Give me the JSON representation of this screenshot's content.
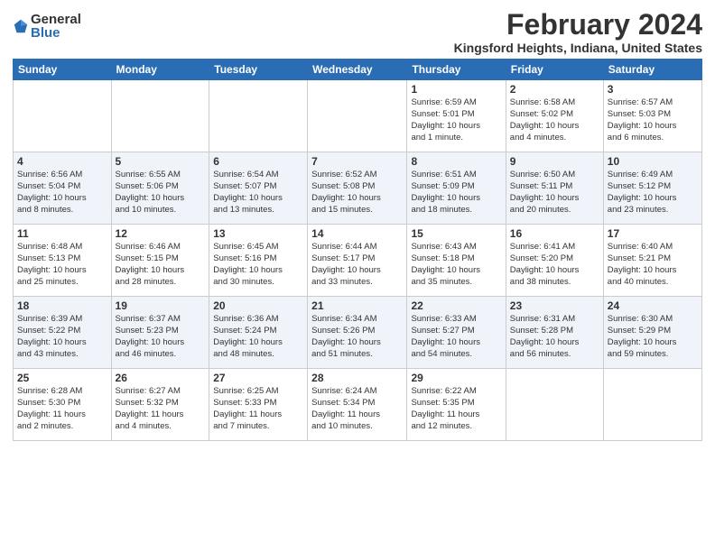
{
  "logo": {
    "general": "General",
    "blue": "Blue"
  },
  "header": {
    "month_year": "February 2024",
    "location": "Kingsford Heights, Indiana, United States"
  },
  "weekdays": [
    "Sunday",
    "Monday",
    "Tuesday",
    "Wednesday",
    "Thursday",
    "Friday",
    "Saturday"
  ],
  "weeks": [
    [
      {
        "day": "",
        "info": ""
      },
      {
        "day": "",
        "info": ""
      },
      {
        "day": "",
        "info": ""
      },
      {
        "day": "",
        "info": ""
      },
      {
        "day": "1",
        "info": "Sunrise: 6:59 AM\nSunset: 5:01 PM\nDaylight: 10 hours\nand 1 minute."
      },
      {
        "day": "2",
        "info": "Sunrise: 6:58 AM\nSunset: 5:02 PM\nDaylight: 10 hours\nand 4 minutes."
      },
      {
        "day": "3",
        "info": "Sunrise: 6:57 AM\nSunset: 5:03 PM\nDaylight: 10 hours\nand 6 minutes."
      }
    ],
    [
      {
        "day": "4",
        "info": "Sunrise: 6:56 AM\nSunset: 5:04 PM\nDaylight: 10 hours\nand 8 minutes."
      },
      {
        "day": "5",
        "info": "Sunrise: 6:55 AM\nSunset: 5:06 PM\nDaylight: 10 hours\nand 10 minutes."
      },
      {
        "day": "6",
        "info": "Sunrise: 6:54 AM\nSunset: 5:07 PM\nDaylight: 10 hours\nand 13 minutes."
      },
      {
        "day": "7",
        "info": "Sunrise: 6:52 AM\nSunset: 5:08 PM\nDaylight: 10 hours\nand 15 minutes."
      },
      {
        "day": "8",
        "info": "Sunrise: 6:51 AM\nSunset: 5:09 PM\nDaylight: 10 hours\nand 18 minutes."
      },
      {
        "day": "9",
        "info": "Sunrise: 6:50 AM\nSunset: 5:11 PM\nDaylight: 10 hours\nand 20 minutes."
      },
      {
        "day": "10",
        "info": "Sunrise: 6:49 AM\nSunset: 5:12 PM\nDaylight: 10 hours\nand 23 minutes."
      }
    ],
    [
      {
        "day": "11",
        "info": "Sunrise: 6:48 AM\nSunset: 5:13 PM\nDaylight: 10 hours\nand 25 minutes."
      },
      {
        "day": "12",
        "info": "Sunrise: 6:46 AM\nSunset: 5:15 PM\nDaylight: 10 hours\nand 28 minutes."
      },
      {
        "day": "13",
        "info": "Sunrise: 6:45 AM\nSunset: 5:16 PM\nDaylight: 10 hours\nand 30 minutes."
      },
      {
        "day": "14",
        "info": "Sunrise: 6:44 AM\nSunset: 5:17 PM\nDaylight: 10 hours\nand 33 minutes."
      },
      {
        "day": "15",
        "info": "Sunrise: 6:43 AM\nSunset: 5:18 PM\nDaylight: 10 hours\nand 35 minutes."
      },
      {
        "day": "16",
        "info": "Sunrise: 6:41 AM\nSunset: 5:20 PM\nDaylight: 10 hours\nand 38 minutes."
      },
      {
        "day": "17",
        "info": "Sunrise: 6:40 AM\nSunset: 5:21 PM\nDaylight: 10 hours\nand 40 minutes."
      }
    ],
    [
      {
        "day": "18",
        "info": "Sunrise: 6:39 AM\nSunset: 5:22 PM\nDaylight: 10 hours\nand 43 minutes."
      },
      {
        "day": "19",
        "info": "Sunrise: 6:37 AM\nSunset: 5:23 PM\nDaylight: 10 hours\nand 46 minutes."
      },
      {
        "day": "20",
        "info": "Sunrise: 6:36 AM\nSunset: 5:24 PM\nDaylight: 10 hours\nand 48 minutes."
      },
      {
        "day": "21",
        "info": "Sunrise: 6:34 AM\nSunset: 5:26 PM\nDaylight: 10 hours\nand 51 minutes."
      },
      {
        "day": "22",
        "info": "Sunrise: 6:33 AM\nSunset: 5:27 PM\nDaylight: 10 hours\nand 54 minutes."
      },
      {
        "day": "23",
        "info": "Sunrise: 6:31 AM\nSunset: 5:28 PM\nDaylight: 10 hours\nand 56 minutes."
      },
      {
        "day": "24",
        "info": "Sunrise: 6:30 AM\nSunset: 5:29 PM\nDaylight: 10 hours\nand 59 minutes."
      }
    ],
    [
      {
        "day": "25",
        "info": "Sunrise: 6:28 AM\nSunset: 5:30 PM\nDaylight: 11 hours\nand 2 minutes."
      },
      {
        "day": "26",
        "info": "Sunrise: 6:27 AM\nSunset: 5:32 PM\nDaylight: 11 hours\nand 4 minutes."
      },
      {
        "day": "27",
        "info": "Sunrise: 6:25 AM\nSunset: 5:33 PM\nDaylight: 11 hours\nand 7 minutes."
      },
      {
        "day": "28",
        "info": "Sunrise: 6:24 AM\nSunset: 5:34 PM\nDaylight: 11 hours\nand 10 minutes."
      },
      {
        "day": "29",
        "info": "Sunrise: 6:22 AM\nSunset: 5:35 PM\nDaylight: 11 hours\nand 12 minutes."
      },
      {
        "day": "",
        "info": ""
      },
      {
        "day": "",
        "info": ""
      }
    ]
  ]
}
